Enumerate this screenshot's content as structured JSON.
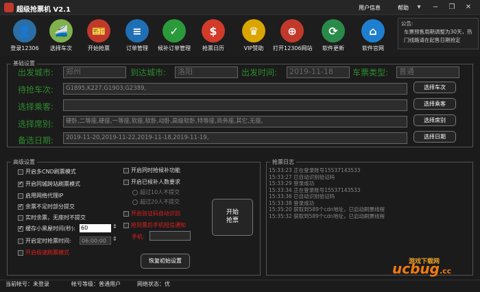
{
  "app": {
    "title": "超级抢票机 V2.1"
  },
  "titlebar": {
    "user_info": "用户信息",
    "help": "帮助"
  },
  "toolbar": [
    {
      "label": "登录12306",
      "icon": "user-login-icon",
      "color": "#2a6ea5",
      "glyph": "👤"
    },
    {
      "label": "选择车次",
      "icon": "train-icon",
      "color": "#7fb24d",
      "glyph": "🚄"
    },
    {
      "label": "开始抢票",
      "icon": "ticket-icon",
      "color": "#c0392b",
      "glyph": "🎫"
    },
    {
      "label": "订单管理",
      "icon": "order-icon",
      "color": "#1f6fb5",
      "glyph": "≡"
    },
    {
      "label": "候补订单管理",
      "icon": "waitlist-icon",
      "color": "#2b9a3a",
      "glyph": "✓"
    },
    {
      "label": "抢票日历",
      "icon": "calendar-icon",
      "color": "#d23a2a",
      "glyph": "$"
    },
    {
      "label": "VIP赞助",
      "icon": "vip-crown-icon",
      "color": "#d9a500",
      "glyph": "♛"
    },
    {
      "label": "打开12306网站",
      "icon": "railway-logo-icon",
      "color": "#c0392b",
      "glyph": "⊕"
    },
    {
      "label": "软件更新",
      "icon": "update-arrows-icon",
      "color": "#2a8a4a",
      "glyph": "⟳"
    },
    {
      "label": "软件官网",
      "icon": "home-icon",
      "color": "#1e7fd0",
      "glyph": "⌂"
    }
  ],
  "notice": {
    "title": "公告:",
    "text": "车票预售周期调整为30天，热门线路请在起售日期抢定"
  },
  "basic": {
    "title": "基础设置",
    "from_label": "出发城市:",
    "from_value": "郑州",
    "to_label": "到达城市:",
    "to_value": "洛阳",
    "date_label": "出发时间:",
    "date_value": "2019-11-18",
    "type_label": "车票类型:",
    "type_value": "普通",
    "trains_label": "待抢车次:",
    "trains_value": "G1895,K227,G1903,G2389,",
    "passenger_label": "选择乘客:",
    "passenger_value": "",
    "seat_label": "选择席别:",
    "seat_value": "硬卧,二等座,硬座,一等座,软座,软卧,动卧,高级软卧,特等座,商务座,其它,无座,",
    "backup_label": "备选日期:",
    "backup_value": "2019-11-20,2019-11-22,2019-11-18,2019-11-19,",
    "btn_train": "选择车次",
    "btn_passenger": "选择乘客",
    "btn_seat": "选择席别",
    "btn_date": "选择日期"
  },
  "advanced": {
    "title": "高级设置",
    "opt_cdn": "开启多CND刷票模式",
    "opt_samecity": "开启同城跨站刷票模式",
    "opt_proxy": "启用网络代理IP",
    "opt_partial": "余票不足时部分提交",
    "opt_realtime": "实时余票，无座时不提交",
    "opt_blacklist": "缓存小黑屋时间(秒):",
    "blacklist_value": "60",
    "opt_timer": "开启定时抢票时间:",
    "timer_value": "06:00:00",
    "opt_fast": "开启极速刷票模式",
    "opt_waitlist_sync": "开启同时抢候补功能",
    "opt_addperson": "开启已候补人数要求",
    "radio_10": "超过10人不提交",
    "radio_20": "超过20人不提交",
    "opt_captcha": "开启验证码自动识别",
    "opt_sms": "抢到票后手机短信通知",
    "phone_label": "手机:",
    "start_button": "开始\n抢票",
    "reset_button": "恢复初始设置"
  },
  "log": {
    "title": "抢票日志",
    "lines": [
      "15:33:23 正在登录账号15537143533",
      "15:33:27 已自动识别验证码",
      "15:33:29 登录成功",
      "15:33:34 正在登录账号15537143533",
      "15:33:36 已自动识别验证码",
      "15:33:38 登录成功",
      "15:35:20 获取到589个cdn地址，已启动刷票线程",
      "15:35:32 获取到589个cdn地址，已启动刷票线程"
    ]
  },
  "status": {
    "account": "当前帐号：未登录",
    "level": "帐号等级：普通用户",
    "network": "网络状态：优"
  },
  "watermark": {
    "brand": "ucbug",
    "domain": ".cc",
    "subtitle": "游戏下载网"
  },
  "colors": {
    "bg": "#1b1b1b",
    "label_green": "#2e8b2e",
    "warning_red": "#e02020"
  }
}
